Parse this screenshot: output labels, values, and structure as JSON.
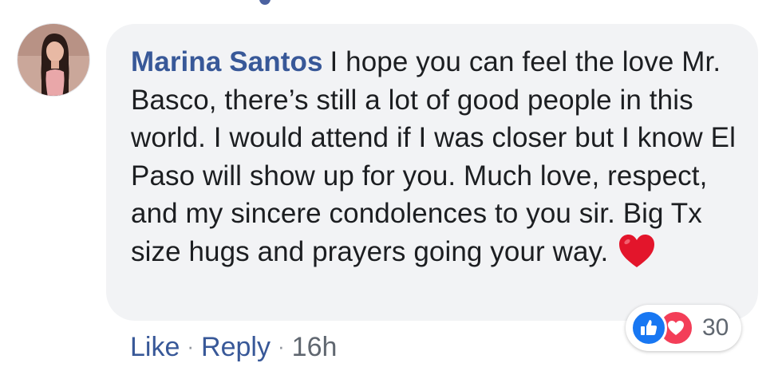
{
  "comment": {
    "author": "Marina Santos",
    "text": "I hope you can feel the love Mr. Basco, there’s still a lot of good people in this world. I would attend if I was closer but I know El Paso will show up for you. Much love, respect, and my sincere condolences to you sir. Big Tx size hugs and prayers going your way.",
    "emoji": "red-heart-emoji"
  },
  "actions": {
    "like_label": "Like",
    "separator": "·",
    "reply_label": "Reply",
    "timestamp": "16h"
  },
  "reactions": {
    "types": [
      "like",
      "love"
    ],
    "count": "30"
  },
  "colors": {
    "author": "#385898",
    "bubble": "#f2f3f5",
    "like_blue": "#1877f2",
    "love_red": "#f33e58"
  }
}
